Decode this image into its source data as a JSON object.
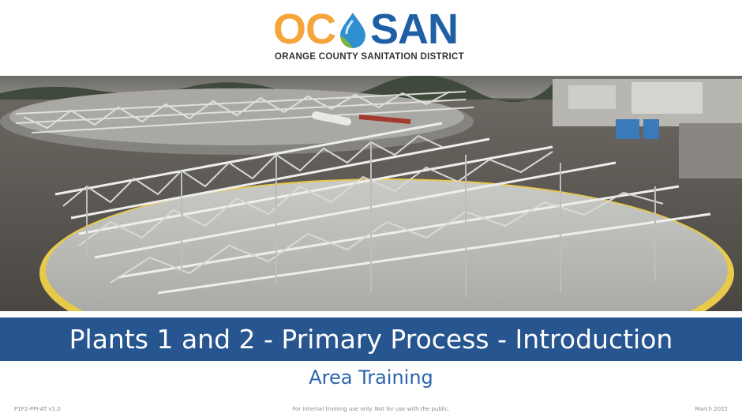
{
  "logo": {
    "part_left": "OC",
    "part_right": "SAN",
    "subtitle": "ORANGE COUNTY SANITATION DISTRICT",
    "colors": {
      "oc": "#f5a53a",
      "san": "#1f5fa6",
      "drop_blue": "#2f8fd0",
      "drop_green": "#7cb342"
    }
  },
  "photo": {
    "icon": "clarifier-photo"
  },
  "slide": {
    "title": "Plants 1 and 2 - Primary Process - Introduction",
    "subtitle": "Area Training",
    "band_color": "#26558f"
  },
  "footer": {
    "doc_id": "P1P2-PPI-AT v1.0",
    "notice": "For internal training use only. Not for use with the public.",
    "date": "March 2022"
  }
}
